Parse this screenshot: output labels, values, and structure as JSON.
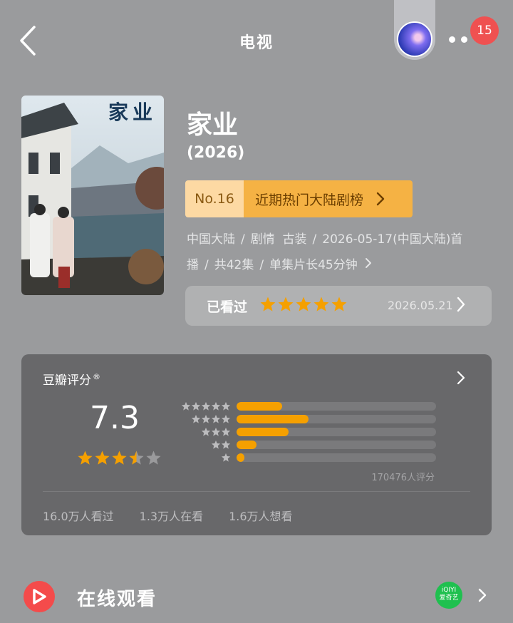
{
  "header": {
    "title": "电视",
    "notification_count": "15"
  },
  "poster": {
    "title_text": "家业"
  },
  "show": {
    "title": "家业",
    "year": "(2026)",
    "rank": {
      "number": "No.16",
      "list_name": "近期热门大陆剧榜"
    },
    "meta": {
      "region": "中国大陆",
      "genre_1": "剧情",
      "genre_2": "古装",
      "premiere": "2026-05-17(中国大陆)首",
      "premiere_cont": "播",
      "episodes": "共42集",
      "duration": "单集片长45分钟"
    }
  },
  "watched": {
    "label": "已看过",
    "my_rating_stars": 5,
    "date": "2026.05.21"
  },
  "douban": {
    "label": "豆瓣评分",
    "registered_mark": "®",
    "score": "7.3",
    "score_stars": 3.5,
    "distribution": [
      {
        "stars": 5,
        "percent": 23
      },
      {
        "stars": 4,
        "percent": 36
      },
      {
        "stars": 3,
        "percent": 26
      },
      {
        "stars": 2,
        "percent": 10
      },
      {
        "stars": 1,
        "percent": 4
      }
    ],
    "rating_count": "170476人评分",
    "stats": {
      "watched": "16.0万人看过",
      "watching": "1.3万人在看",
      "want": "1.6万人想看"
    }
  },
  "online": {
    "label": "在线观看",
    "provider_logo": "iQIYI\n爱奇艺"
  },
  "colors": {
    "background": "#9a9b9d",
    "star": "#f5a000",
    "badge": "#ef5151",
    "play": "#f44b4b",
    "iqiyi": "#1fc04f"
  }
}
